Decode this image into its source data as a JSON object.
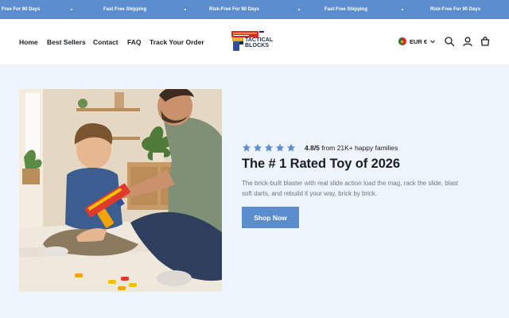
{
  "announcement": {
    "items": [
      "Free For 90 Days",
      "Fast Free Shipping",
      "Risk-Free For 90 Days",
      "Fast Free Shipping",
      "Risk-Free For 90 Days"
    ]
  },
  "nav": {
    "items": [
      "Home",
      "Best Sellers",
      "Contact",
      "FAQ",
      "Track Your Order"
    ]
  },
  "logo": {
    "line1": "TACTICAL",
    "line2": "BLOCKS"
  },
  "locale": {
    "label": "EUR €",
    "flag": "portugal-flag-icon"
  },
  "header_icons": [
    "search-icon",
    "account-icon",
    "cart-icon"
  ],
  "hero": {
    "rating_value": "4.8/5",
    "rating_suffix": " from 21K+ happy families",
    "stars": 5,
    "headline": "The # 1 Rated Toy of 2026",
    "description": "The brick-built blaster with real slide action load the mag, rack the slide, blast soft darts, and rebuild it your way, brick by brick.",
    "cta_label": "Shop Now"
  },
  "colors": {
    "accent": "#5b8ccb",
    "page_background": "#eef4fb",
    "star": "#5b8ccb"
  }
}
